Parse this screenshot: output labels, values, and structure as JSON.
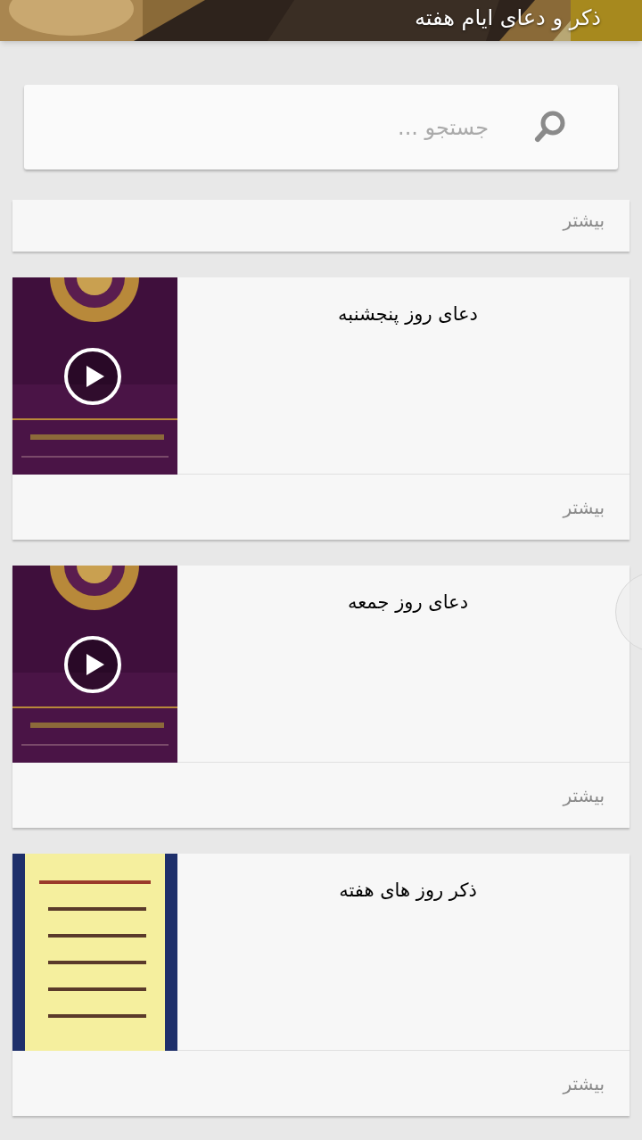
{
  "header": {
    "title": "ذکر و دعای ایام هفته"
  },
  "search": {
    "placeholder": "جستجو ..."
  },
  "partial_card": {
    "more": "بیشتر"
  },
  "cards": [
    {
      "title": "دعای روز پنجشنبه",
      "kind": "video",
      "more": "بیشتر"
    },
    {
      "title": "دعای روز جمعه",
      "kind": "video",
      "more": "بیشتر"
    },
    {
      "title": "ذکر روز های هفته",
      "more": "بیشتر"
    }
  ]
}
